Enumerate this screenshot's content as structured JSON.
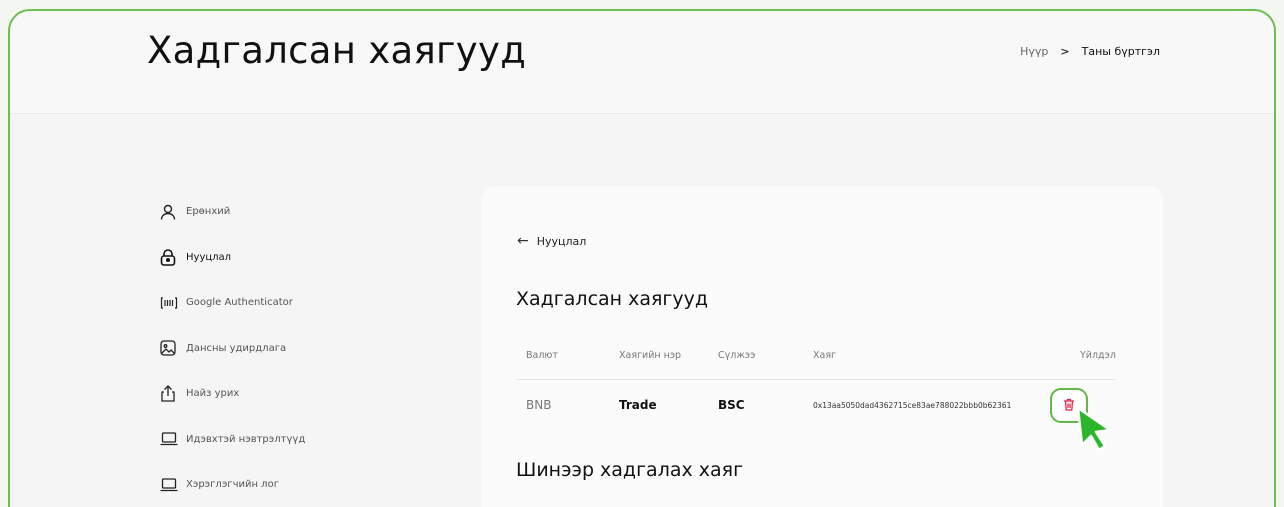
{
  "header": {
    "title": "Хадгалсан хаягууд",
    "breadcrumb": {
      "home": "Нүүр",
      "separator": ">",
      "current": "Таны бүртгэл"
    }
  },
  "sidebar": {
    "items": [
      {
        "label": "Ерөнхий",
        "icon": "user-icon",
        "active": false
      },
      {
        "label": "Нууцлал",
        "icon": "lock-icon",
        "active": true
      },
      {
        "label": "Google Authenticator",
        "icon": "authenticator-icon",
        "active": false
      },
      {
        "label": "Дансны удирдлага",
        "icon": "image-icon",
        "active": false
      },
      {
        "label": "Найз урих",
        "icon": "share-icon",
        "active": false
      },
      {
        "label": "Идэвхтэй нэвтрэлтүүд",
        "icon": "laptop-icon",
        "active": false
      },
      {
        "label": "Хэрэглэгчийн лог",
        "icon": "laptop-icon",
        "active": false
      }
    ]
  },
  "main": {
    "back_label": "Нууцлал",
    "title": "Хадгалсан хаягууд",
    "table": {
      "columns": [
        "Валют",
        "Хаягийн нэр",
        "Сүлжээ",
        "Хаяг",
        "Үйлдэл"
      ],
      "rows": [
        {
          "currency": "BNB",
          "name": "Trade",
          "network": "BSC",
          "address": "0x13aa5050dad4362715ce83ae788022bbb0b62361",
          "action_icon": "trash-icon"
        }
      ]
    },
    "new_section_title": "Шинээр хадгалах хаяг"
  },
  "colors": {
    "highlight_green": "#5fb847",
    "delete_red": "#e0264a",
    "cursor_green": "#2bb52b"
  }
}
